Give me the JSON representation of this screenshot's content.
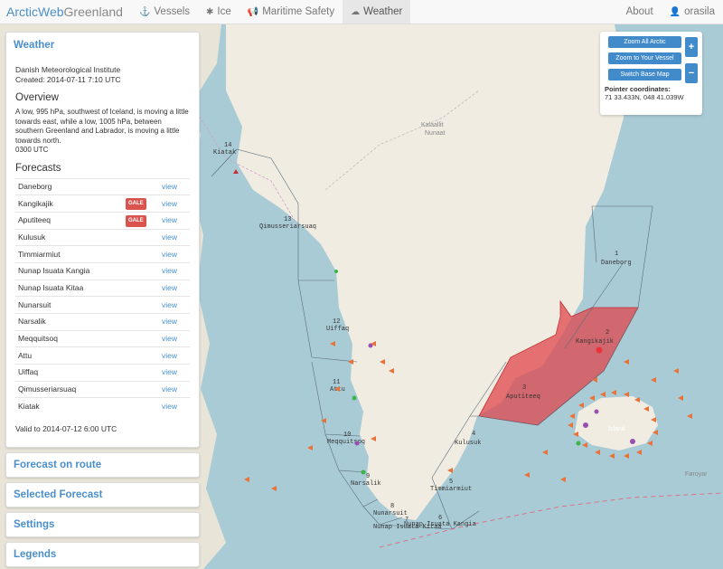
{
  "nav": {
    "brand_main": "ArcticWeb",
    "brand_sub": "Greenland",
    "items": [
      {
        "label": "Vessels",
        "icon": "anchor-icon"
      },
      {
        "label": "Ice",
        "icon": "snowflake-icon"
      },
      {
        "label": "Maritime Safety",
        "icon": "bullhorn-icon"
      },
      {
        "label": "Weather",
        "icon": "cloud-icon"
      }
    ],
    "about": "About",
    "user": "orasila"
  },
  "weather": {
    "title": "Weather",
    "source": "Danish Meteorological Institute",
    "created": "Created: 2014-07-11 7:10 UTC",
    "overview_title": "Overview",
    "overview_text": "A low, 995 hPa, southwest of Iceland, is moving a little towards east, while a low, 1005 hPa, between southern Greenland and Labrador, is moving a little towards north.",
    "overview_time": "0300 UTC",
    "forecasts_title": "Forecasts",
    "view_label": "view",
    "gale_label": "GALE",
    "forecasts": [
      {
        "name": "Daneborg",
        "gale": false
      },
      {
        "name": "Kangikajik",
        "gale": true
      },
      {
        "name": "Aputiteeq",
        "gale": true
      },
      {
        "name": "Kulusuk",
        "gale": false
      },
      {
        "name": "Timmiarmiut",
        "gale": false
      },
      {
        "name": "Nunap Isuata Kangia",
        "gale": false
      },
      {
        "name": "Nunap Isuata Kitaa",
        "gale": false
      },
      {
        "name": "Nunarsuit",
        "gale": false
      },
      {
        "name": "Narsalik",
        "gale": false
      },
      {
        "name": "Meqquitsoq",
        "gale": false
      },
      {
        "name": "Attu",
        "gale": false
      },
      {
        "name": "Uiffaq",
        "gale": false
      },
      {
        "name": "Qimusseriarsuaq",
        "gale": false
      },
      {
        "name": "Kiatak",
        "gale": false
      }
    ],
    "valid_to": "Valid to 2014-07-12 6:00 UTC"
  },
  "panels": {
    "forecast_on_route": "Forecast on route",
    "selected_forecast": "Selected Forecast",
    "settings": "Settings",
    "legends": "Legends"
  },
  "map_controls": {
    "zoom_all": "Zoom All Arctic",
    "zoom_vessel": "Zoom to Your Vessel",
    "switch_base": "Switch Base Map",
    "pointer_label": "Pointer coordinates:",
    "pointer_value": "71 33.433N, 048 41.039W",
    "zoom_in": "+",
    "zoom_out": "−"
  },
  "map": {
    "region_labels": [
      {
        "num": "14",
        "name": "Kiatak"
      },
      {
        "num": "13",
        "name": "Qimusseriarsuaq"
      },
      {
        "num": "12",
        "name": "Uiffaq"
      },
      {
        "num": "11",
        "name": "Attu"
      },
      {
        "num": "10",
        "name": "Meqquitsoq"
      },
      {
        "num": "9",
        "name": "Narsalik"
      },
      {
        "num": "8",
        "name": "Nunarsuit"
      },
      {
        "num": "7",
        "name": "Nunap Isuata Kitaa"
      },
      {
        "num": "6",
        "name": "Nunap Isuata Kangia"
      },
      {
        "num": "5",
        "name": "Timmiarmiut"
      },
      {
        "num": "4",
        "name": "Kulusuk"
      },
      {
        "num": "3",
        "name": "Aputiteeq"
      },
      {
        "num": "2",
        "name": "Kangikajik"
      },
      {
        "num": "1",
        "name": "Daneborg"
      }
    ],
    "place_labels": [
      "Kalaallit",
      "Nunaat",
      "Island",
      "Føroyar"
    ],
    "colors": {
      "sea": "#a9cbd6",
      "land": "#efeae2",
      "gale": "#e0474c",
      "vessel": "#e8733a"
    }
  }
}
